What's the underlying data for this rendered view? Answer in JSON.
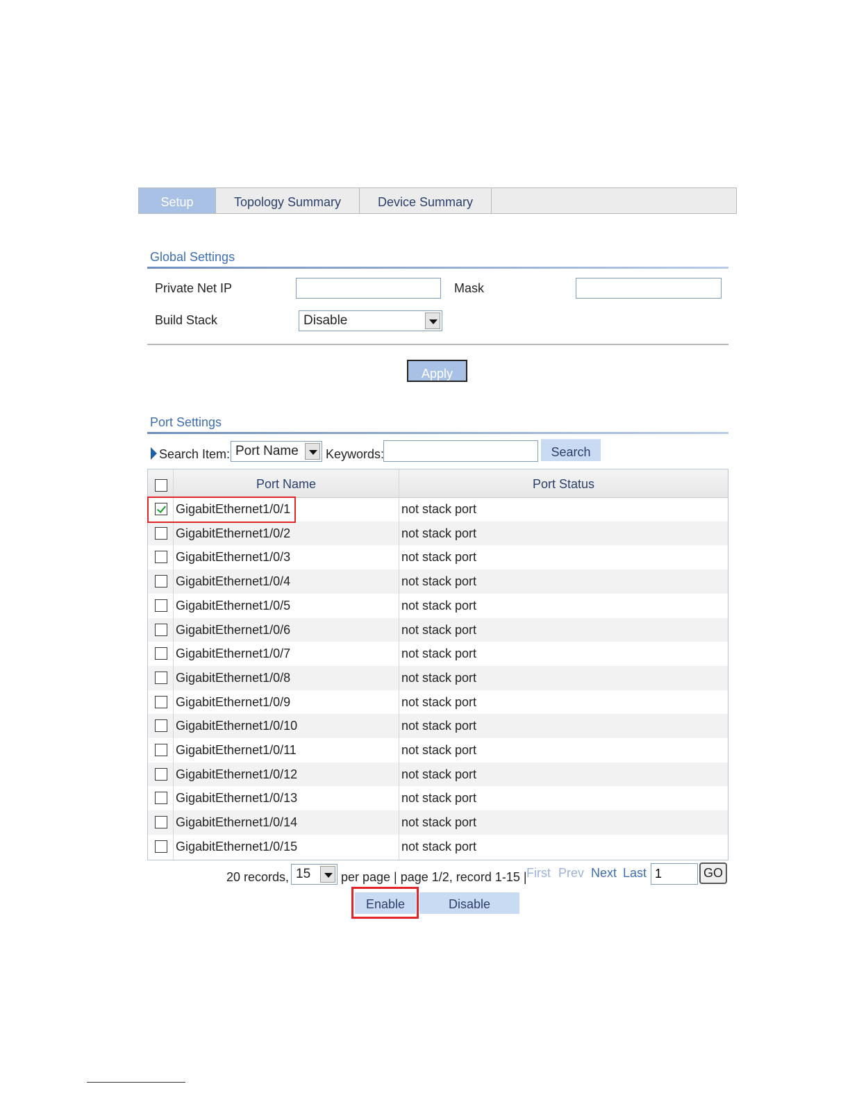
{
  "tabs": [
    {
      "label": "Setup",
      "active": true
    },
    {
      "label": "Topology Summary",
      "active": false
    },
    {
      "label": "Device Summary",
      "active": false
    }
  ],
  "global": {
    "title": "Global Settings",
    "private_ip_label": "Private Net IP",
    "private_ip_value": "",
    "mask_label": "Mask",
    "mask_value": "",
    "build_stack_label": "Build Stack",
    "build_stack_value": "Disable",
    "apply_label": "Apply"
  },
  "port": {
    "title": "Port Settings",
    "search_item_label": "Search Item:",
    "search_item_value": "Port Name",
    "keywords_label": "Keywords:",
    "keywords_value": "",
    "search_button": "Search",
    "columns": [
      "Port Name",
      "Port Status"
    ],
    "rows": [
      {
        "name": "GigabitEthernet1/0/1",
        "status": "not stack port",
        "checked": true
      },
      {
        "name": "GigabitEthernet1/0/2",
        "status": "not stack port",
        "checked": false
      },
      {
        "name": "GigabitEthernet1/0/3",
        "status": "not stack port",
        "checked": false
      },
      {
        "name": "GigabitEthernet1/0/4",
        "status": "not stack port",
        "checked": false
      },
      {
        "name": "GigabitEthernet1/0/5",
        "status": "not stack port",
        "checked": false
      },
      {
        "name": "GigabitEthernet1/0/6",
        "status": "not stack port",
        "checked": false
      },
      {
        "name": "GigabitEthernet1/0/7",
        "status": "not stack port",
        "checked": false
      },
      {
        "name": "GigabitEthernet1/0/8",
        "status": "not stack port",
        "checked": false
      },
      {
        "name": "GigabitEthernet1/0/9",
        "status": "not stack port",
        "checked": false
      },
      {
        "name": "GigabitEthernet1/0/10",
        "status": "not stack port",
        "checked": false
      },
      {
        "name": "GigabitEthernet1/0/11",
        "status": "not stack port",
        "checked": false
      },
      {
        "name": "GigabitEthernet1/0/12",
        "status": "not stack port",
        "checked": false
      },
      {
        "name": "GigabitEthernet1/0/13",
        "status": "not stack port",
        "checked": false
      },
      {
        "name": "GigabitEthernet1/0/14",
        "status": "not stack port",
        "checked": false
      },
      {
        "name": "GigabitEthernet1/0/15",
        "status": "not stack port",
        "checked": false
      }
    ],
    "pager": {
      "records": "20 records,",
      "per_page_value": "15",
      "info": "per page | page 1/2, record 1-15 |",
      "first": "First",
      "prev": "Prev",
      "next": "Next",
      "last": "Last",
      "page_input": "1",
      "go": "GO"
    },
    "enable_label": "Enable",
    "disable_label": "Disable"
  },
  "colors": {
    "tab_active": "#a9c1e5",
    "heading": "#3d6eb3",
    "highlight": "#e0262a"
  }
}
